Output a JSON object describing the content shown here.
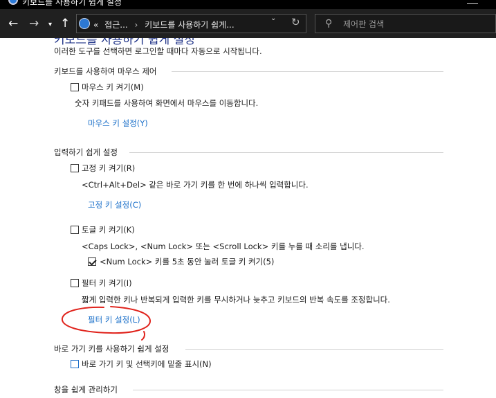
{
  "window": {
    "title": "키보드를 사용하기 쉽게 설정"
  },
  "nav": {
    "back": "←",
    "forward": "→",
    "recent": "▾",
    "up": "↑",
    "breadcrumb_overflow": "«",
    "breadcrumb": [
      "접근...",
      "키보드를 사용하기 쉽게..."
    ],
    "dropdown": "⌄",
    "refresh": "↻",
    "search_placeholder": "제어판 검색",
    "search_icon": "⚲"
  },
  "page": {
    "title": "키보드를 사용하기 쉽게 설정",
    "intro": "이러한 도구를 선택하면 로그인할 때마다 자동으로 시작됩니다."
  },
  "sections": {
    "mouse": {
      "heading": "키보드를 사용하여 마우스 제어",
      "mouse_keys_label": "마우스 키 켜기(M)",
      "mouse_keys_checked": false,
      "mouse_keys_desc": "숫자 키패드를 사용하여 화면에서 마우스를 이동합니다.",
      "mouse_keys_link": "마우스 키 설정(Y)"
    },
    "typing": {
      "heading": "입력하기 쉽게 설정",
      "sticky_label": "고정 키 켜기(R)",
      "sticky_checked": false,
      "sticky_desc": "<Ctrl+Alt+Del> 같은 바로 가기 키를 한 번에 하나씩 입력합니다.",
      "sticky_link": "고정 키 설정(C)",
      "toggle_label": "토글 키 켜기(K)",
      "toggle_checked": false,
      "toggle_desc": "<Caps Lock>, <Num Lock> 또는 <Scroll Lock> 키를 누를 때 소리를 냅니다.",
      "numlock_label": "<Num Lock> 키를 5초 동안 눌러 토글 키 켜기(5)",
      "numlock_checked": true,
      "filter_label": "필터 키 켜기(I)",
      "filter_checked": false,
      "filter_desc": "짧게 입력한 키나 반복되게 입력한 키를 무시하거나 늦추고 키보드의 반복 속도를 조정합니다.",
      "filter_link": "필터 키 설정(L)"
    },
    "shortcuts": {
      "heading": "바로 가기 키를 사용하기 쉽게 설정",
      "underline_label": "바로 가기 키 및 선택키에 밑줄 표시(N)",
      "underline_checked": false
    },
    "windows": {
      "heading": "창을 쉽게 관리하기"
    }
  },
  "colors": {
    "link": "#1a6fc9",
    "title": "#1e3287",
    "annotation": "#e0231c",
    "navbar": "#202020"
  }
}
